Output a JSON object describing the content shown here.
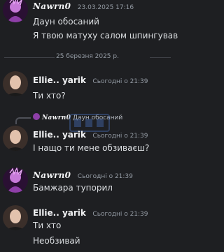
{
  "messages": [
    {
      "user": "Nawrn0",
      "time": "23.03.2025 17:16",
      "lines": [
        "Даун обосаний",
        "Я твою матуху салом шпингував"
      ],
      "avatar": "purple-punk-avatar"
    },
    {
      "user": "Ellie.. yarik",
      "time": "Сьогодні о 21:39",
      "lines": [
        "Ти хто?"
      ],
      "avatar": "person-photo-avatar"
    },
    {
      "reply": {
        "user": "Nawrn0",
        "text": "Даун обосаний"
      },
      "user": "Ellie.. yarik",
      "time": "Сьогодні о 21:39",
      "lines": [
        "І нащо ти мене обзиваєш?"
      ],
      "avatar": "person-photo-avatar"
    },
    {
      "user": "Nawrn0",
      "time": "Сьогодні о 21:39",
      "lines": [
        "Бамжара тупорил"
      ],
      "avatar": "purple-punk-avatar"
    },
    {
      "user": "Ellie.. yarik",
      "time": "Сьогодні о 21:39",
      "lines": [
        "Ти хто",
        "Необзивай"
      ],
      "avatar": "person-photo-avatar"
    }
  ],
  "divider": {
    "label": "25 березня 2025 р."
  },
  "colors": {
    "background": "#1e1f22",
    "text": "#dbdee1",
    "muted": "#949ba4",
    "username": "#f2f3f5",
    "avatar_purple": "#8e3fa8",
    "watermark": "#4f7fd8"
  }
}
